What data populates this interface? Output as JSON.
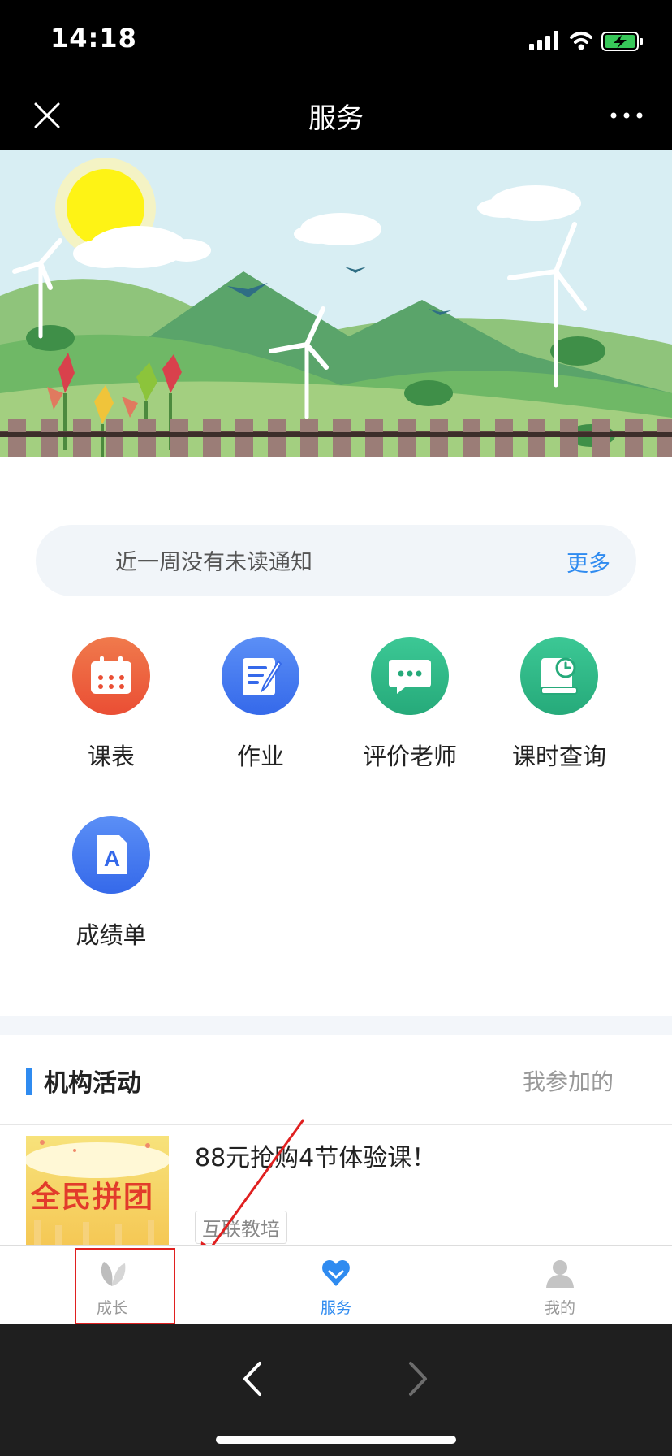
{
  "status_bar": {
    "time": "14:18"
  },
  "top_bar": {
    "title": "服务"
  },
  "notice": {
    "text": "近一周没有未读通知",
    "more": "更多"
  },
  "services": [
    {
      "label": "课表",
      "icon": "calendar-icon",
      "color": "#ef5a3c"
    },
    {
      "label": "作业",
      "icon": "homework-edit-icon",
      "color": "#3f7ef2"
    },
    {
      "label": "评价老师",
      "icon": "chat-bubble-icon",
      "color": "#2fba8a"
    },
    {
      "label": "课时查询",
      "icon": "book-clock-icon",
      "color": "#2fba8a"
    },
    {
      "label": "成绩单",
      "icon": "grade-report-icon",
      "color": "#3f7ef2"
    }
  ],
  "activities": {
    "title": "机构活动",
    "mine": "我参加的",
    "items": [
      {
        "title": "88元抢购4节体验课！",
        "tag": "互联教培",
        "thumb_text": "全民拼团"
      }
    ]
  },
  "tabbar": {
    "items": [
      {
        "label": "成长",
        "icon": "leaf-icon",
        "active": false
      },
      {
        "label": "服务",
        "icon": "heart-icon",
        "active": true
      },
      {
        "label": "我的",
        "icon": "user-icon",
        "active": false
      }
    ]
  },
  "colors": {
    "accent": "#2f8bf0",
    "highlight": "#e02020"
  }
}
